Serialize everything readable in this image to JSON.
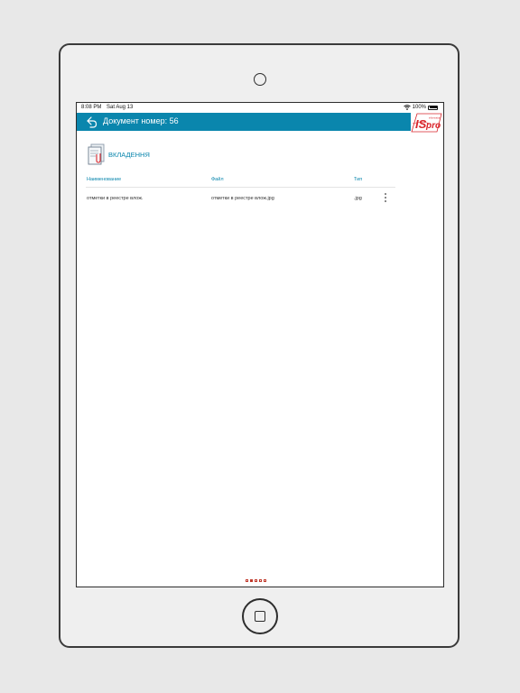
{
  "status": {
    "time": "8:08 PM",
    "date": "Sat Aug 13",
    "battery": "100%"
  },
  "header": {
    "title": "Документ номер: 56",
    "back_icon": "back-arrow-icon"
  },
  "logo": {
    "brand": "IS",
    "sub": "pro",
    "small": "information",
    "color": "#d9262c"
  },
  "section": {
    "title": "ВКЛАДЕННЯ",
    "icon": "document-attachment-icon"
  },
  "table": {
    "headers": [
      "Наименование",
      "Файл",
      "Тип"
    ],
    "rows": [
      {
        "name": "отметки в реестре влож.",
        "file": "отметки в реестре влож.jpg",
        "type": ".jpg"
      }
    ]
  },
  "pager": {
    "count": 5,
    "active": 1
  },
  "colors": {
    "accent": "#0a86ad",
    "pager": "#c0392b"
  }
}
